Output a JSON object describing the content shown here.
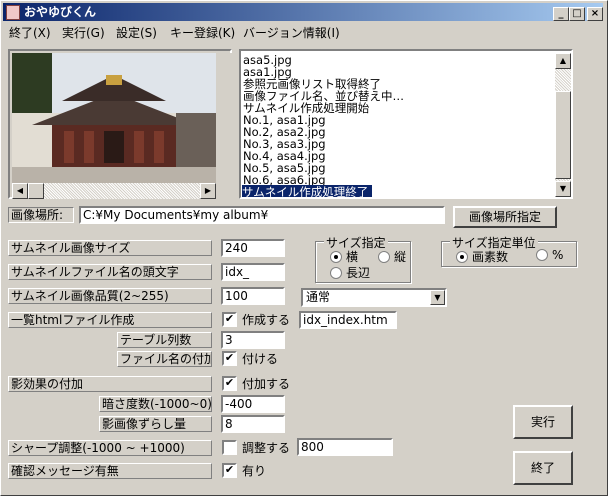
{
  "window": {
    "title": "おやゆびくん",
    "minimize": "_",
    "maximize": "□",
    "close": "×"
  },
  "menu": [
    "終了(X)",
    "実行(G)",
    "設定(S)",
    "キー登録(K)",
    "バージョン情報(I)"
  ],
  "log": {
    "lines": [
      "asa5.jpg",
      "asa1.jpg",
      "参照元画像リスト取得終了",
      "画像ファイル名、並び替え中…",
      "サムネイル作成処理開始",
      "No.1, asa1.jpg",
      "No.2, asa2.jpg",
      "No.3, asa3.jpg",
      "No.4, asa4.jpg",
      "No.5, asa5.jpg",
      "No.6, asa6.jpg"
    ],
    "selected": "サムネイル作成処理終了"
  },
  "image_location": {
    "label": "画像場所:",
    "value": "C:¥My Documents¥my album¥",
    "button": "画像場所指定"
  },
  "settings": {
    "thumb_size": {
      "label": "サムネイル画像サイズ",
      "value": "240"
    },
    "thumb_prefix": {
      "label": "サムネイルファイル名の頭文字",
      "value": "idx_"
    },
    "thumb_quality": {
      "label": "サムネイル画像品質(2~255)",
      "value": "100"
    },
    "quality_select": "通常",
    "html_index": {
      "label": "一覧htmlファイル作成",
      "check_label": "作成する",
      "checked": true,
      "value": "idx_index.htm"
    },
    "table_cols": {
      "label": "テーブル列数",
      "value": "3"
    },
    "filename_attach": {
      "label": "ファイル名の付加",
      "check_label": "付ける",
      "checked": true
    },
    "shadow": {
      "label": "影効果の付加",
      "check_label": "付加する",
      "checked": true
    },
    "darkness": {
      "label": "暗さ度数(-1000~0)",
      "value": "-400"
    },
    "shadow_offset": {
      "label": "影画像ずらし量",
      "value": "8"
    },
    "sharpen": {
      "label": "シャープ調整(-1000 ~ +1000)",
      "check_label": "調整する",
      "checked": false,
      "value": "800"
    },
    "confirm": {
      "label": "確認メッセージ有無",
      "check_label": "有り",
      "checked": true
    }
  },
  "size_group": {
    "title": "サイズ指定",
    "options": [
      "横",
      "縦",
      "長辺"
    ],
    "selected": "横"
  },
  "unit_group": {
    "title": "サイズ指定単位",
    "options": [
      "画素数",
      "%"
    ],
    "selected": "画素数"
  },
  "buttons": {
    "run": "実行",
    "exit": "終了"
  },
  "check_mark": "✔"
}
